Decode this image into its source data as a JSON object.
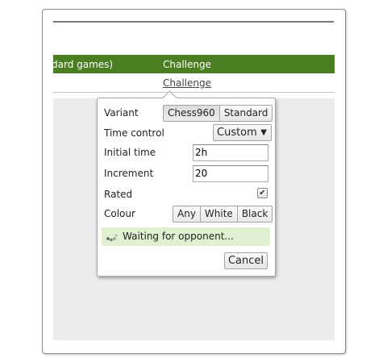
{
  "table": {
    "header_col1": "dard games)",
    "header_col2": "Challenge",
    "challenge_link": "Challenge"
  },
  "popup": {
    "variant": {
      "label": "Variant",
      "options": [
        "Chess960",
        "Standard"
      ],
      "selected": "Chess960"
    },
    "time_control": {
      "label": "Time control",
      "value": "Custom",
      "arrow": "▼"
    },
    "initial_time": {
      "label": "Initial time",
      "value": "2h"
    },
    "increment": {
      "label": "Increment",
      "value": "20"
    },
    "rated": {
      "label": "Rated",
      "checked": true,
      "mark": "✔"
    },
    "colour": {
      "label": "Colour",
      "options": [
        "Any",
        "White",
        "Black"
      ]
    },
    "status": {
      "text": "Waiting for opponent...",
      "icon": "spinner-icon"
    },
    "cancel_label": "Cancel"
  },
  "colors": {
    "header_green": "#4b7e23",
    "waiting_bg": "#e1f0d2",
    "gray_area": "#ececec"
  }
}
